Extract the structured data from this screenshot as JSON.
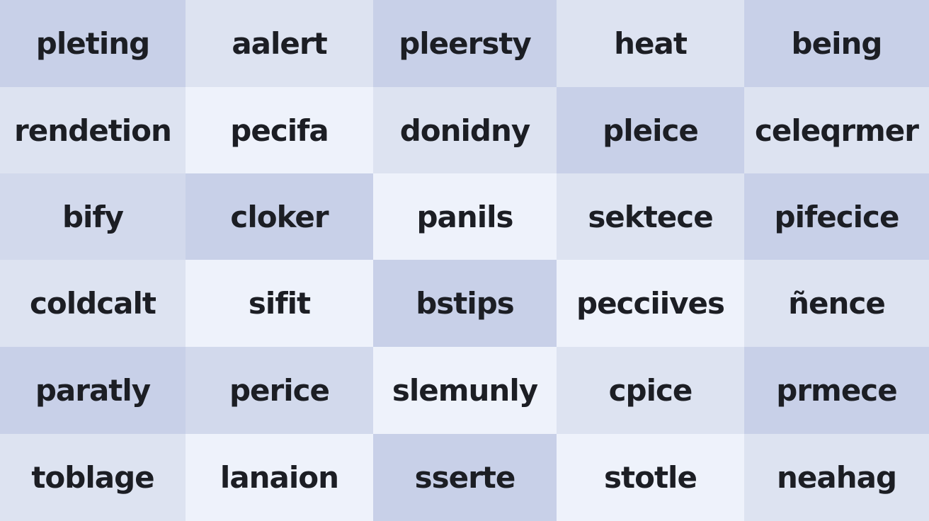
{
  "grid": {
    "rows": [
      [
        {
          "word": "pleting",
          "shade": "dark"
        },
        {
          "word": "aalert",
          "shade": "light"
        },
        {
          "word": "pleersty",
          "shade": "dark"
        },
        {
          "word": "heat",
          "shade": "light"
        },
        {
          "word": "being",
          "shade": "dark"
        }
      ],
      [
        {
          "word": "rendetion",
          "shade": "light"
        },
        {
          "word": "pecifa",
          "shade": "lightest"
        },
        {
          "word": "donidny",
          "shade": "light"
        },
        {
          "word": "pleice",
          "shade": "dark"
        },
        {
          "word": "celeqrmer",
          "shade": "light"
        }
      ],
      [
        {
          "word": "bify",
          "shade": "mid"
        },
        {
          "word": "cloker",
          "shade": "dark"
        },
        {
          "word": "panils",
          "shade": "lightest"
        },
        {
          "word": "sektece",
          "shade": "light"
        },
        {
          "word": "pifecice",
          "shade": "dark"
        }
      ],
      [
        {
          "word": "coldcalt",
          "shade": "light"
        },
        {
          "word": "sifit",
          "shade": "lightest"
        },
        {
          "word": "bstips",
          "shade": "dark"
        },
        {
          "word": "pecciives",
          "shade": "lightest"
        },
        {
          "word": "ñence",
          "shade": "light"
        }
      ],
      [
        {
          "word": "paratly",
          "shade": "dark"
        },
        {
          "word": "perice",
          "shade": "mid"
        },
        {
          "word": "slemunly",
          "shade": "lightest"
        },
        {
          "word": "cpice",
          "shade": "light"
        },
        {
          "word": "prmece",
          "shade": "dark"
        }
      ],
      [
        {
          "word": "toblage",
          "shade": "light"
        },
        {
          "word": "lanaion",
          "shade": "lightest"
        },
        {
          "word": "sserte",
          "shade": "dark"
        },
        {
          "word": "stotle",
          "shade": "lightest"
        },
        {
          "word": "neahag",
          "shade": "light"
        }
      ]
    ]
  },
  "colors": {
    "dark": "#c8d0e8",
    "mid": "#d2d9ec",
    "light": "#dde3f1",
    "lightest": "#eef2fb",
    "text": "#1c1e24"
  }
}
